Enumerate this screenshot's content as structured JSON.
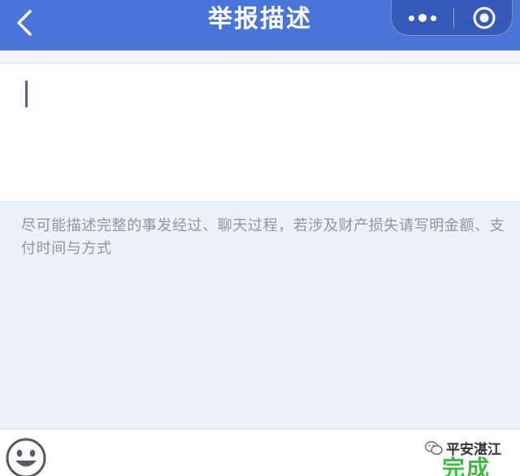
{
  "header": {
    "title": "举报描述",
    "back_icon": "chevron-left-icon",
    "more_icon": "more-dots-icon",
    "close_icon": "target-circle-icon",
    "bar_color": "#4a74d8"
  },
  "description": {
    "value": "",
    "hint": "尽可能描述完整的事发经过、聊天过程，若涉及财产损失请写明金额、支付时间与方式"
  },
  "bottom_bar": {
    "emoji_icon": "smiley-face-icon",
    "done_label": "完成",
    "done_color": "#3fbb45"
  },
  "watermark": {
    "text": "平安湛江",
    "icon": "wechat-logo-icon"
  }
}
